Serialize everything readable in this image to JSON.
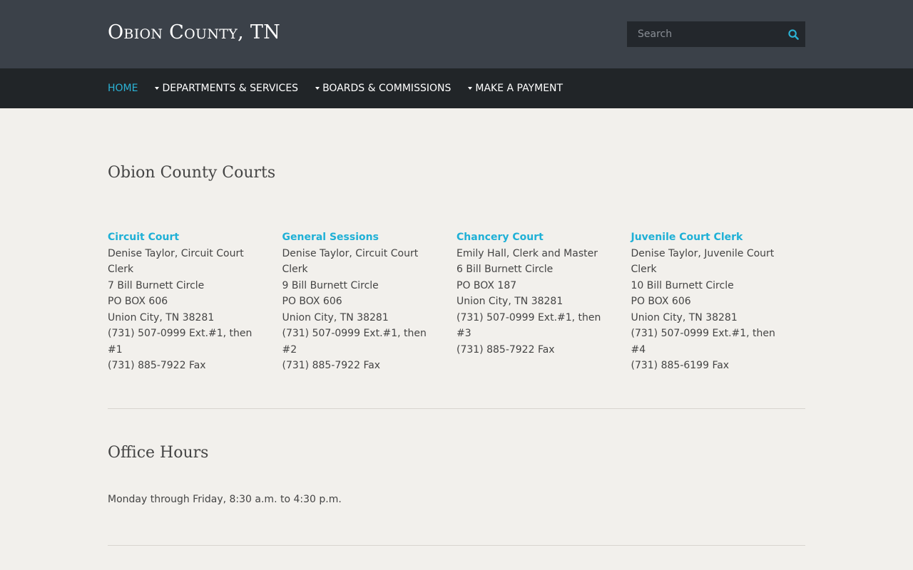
{
  "header": {
    "site_title": "Obion County, TN",
    "search_placeholder": "Search"
  },
  "nav": {
    "items": [
      {
        "label": "HOME",
        "active": true,
        "dropdown": false
      },
      {
        "label": "DEPARTMENTS & SERVICES",
        "active": false,
        "dropdown": true
      },
      {
        "label": "BOARDS & COMMISSIONS",
        "active": false,
        "dropdown": true
      },
      {
        "label": "MAKE A PAYMENT",
        "active": false,
        "dropdown": true
      }
    ]
  },
  "courts": {
    "title": "Obion County Courts",
    "items": [
      {
        "name": "Circuit Court",
        "clerk": "Denise Taylor, Circuit Court Clerk",
        "address": "7 Bill Burnett Circle",
        "po_box": "PO BOX 606",
        "city": "Union City, TN 38281",
        "phone": "(731) 507-0999 Ext.#1, then #1",
        "fax": "(731) 885-7922 Fax"
      },
      {
        "name": "General Sessions",
        "clerk": "Denise Taylor, Circuit Court Clerk",
        "address": "9 Bill Burnett Circle",
        "po_box": "PO BOX 606",
        "city": "Union City, TN 38281",
        "phone": "(731) 507-0999 Ext.#1, then #2",
        "fax": "(731) 885-7922 Fax"
      },
      {
        "name": "Chancery Court",
        "clerk": "Emily Hall, Clerk and Master",
        "address": "6 Bill Burnett Circle",
        "po_box": "PO BOX 187",
        "city": "Union City, TN 38281",
        "phone": "(731) 507-0999 Ext.#1, then #3",
        "fax": "(731) 885-7922 Fax"
      },
      {
        "name": "Juvenile Court Clerk",
        "clerk": "Denise Taylor, Juvenile Court Clerk",
        "address": "10 Bill Burnett Circle",
        "po_box": "PO BOX 606",
        "city": "Union City, TN 38281",
        "phone": "(731) 507-0999 Ext.#1, then #4",
        "fax": "(731) 885-6199 Fax"
      }
    ]
  },
  "office_hours": {
    "title": "Office Hours",
    "text": "Monday through Friday, 8:30 a.m. to 4:30 p.m."
  },
  "colors": {
    "header_bg": "#3b4149",
    "nav_bg": "#212528",
    "accent": "#1fb0d6",
    "page_bg": "#f2f0ec"
  },
  "icons": {
    "search": "search-icon",
    "dropdown": "caret-down-icon"
  }
}
